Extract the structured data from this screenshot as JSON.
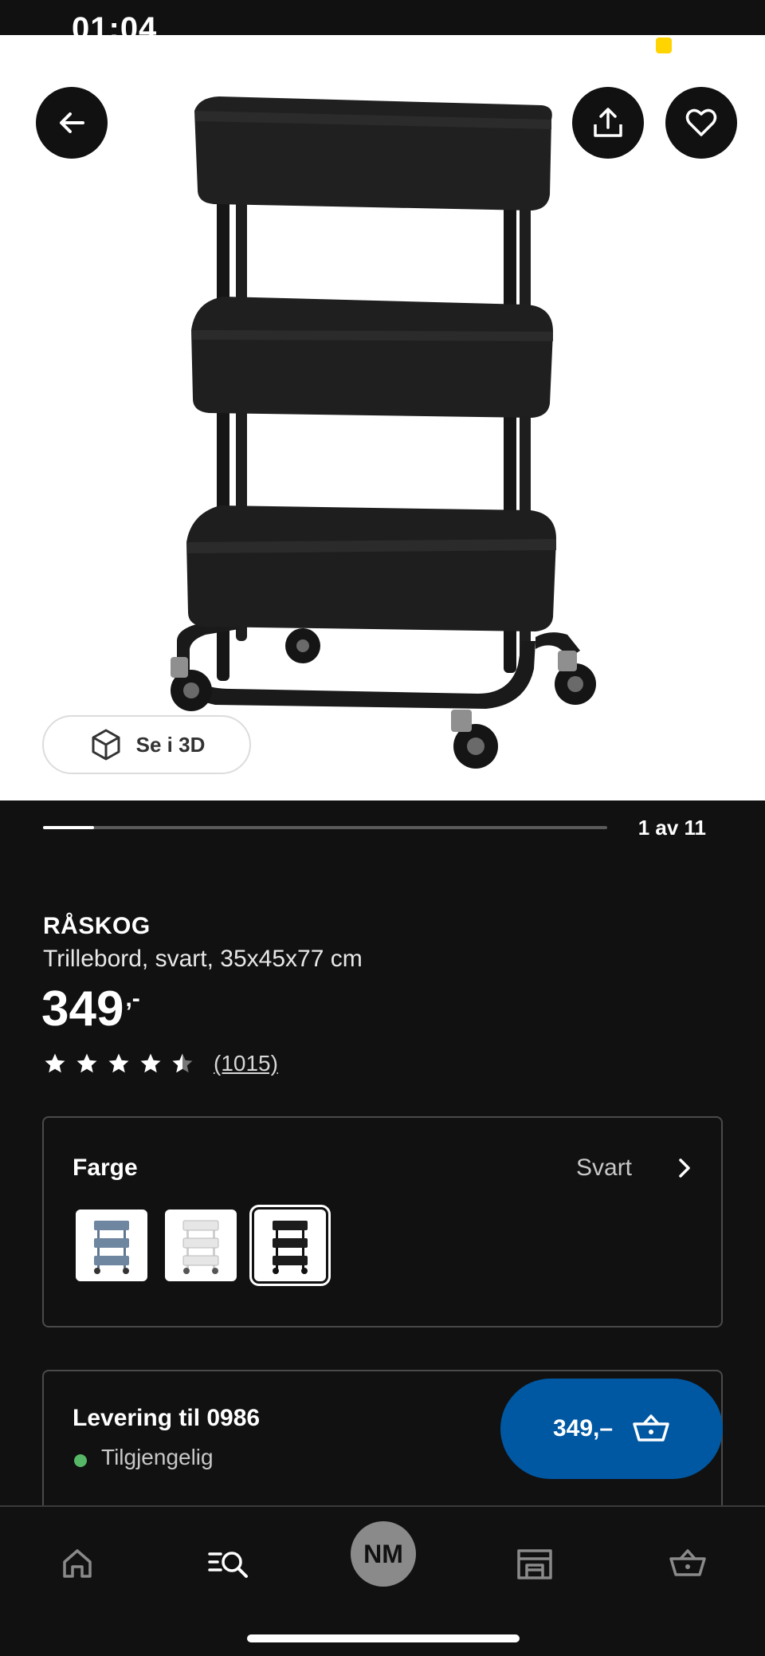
{
  "status_bar": {
    "time": "01:04"
  },
  "gallery": {
    "view_3d_label": "Se i 3D",
    "current": 1,
    "total": 11,
    "counter_text": "1 av 11",
    "progress_fraction": 0.09
  },
  "product": {
    "name": "RÅSKOG",
    "description": "Trillebord, svart, 35x45x77 cm",
    "price": "349",
    "price_suffix": ",-",
    "rating": 4.5,
    "review_count": "(1015)"
  },
  "color_selector": {
    "title": "Farge",
    "selected_value": "Svart",
    "options": [
      {
        "name": "blue-grey",
        "color": "#6f86a0"
      },
      {
        "name": "white",
        "color": "#e9e9e9"
      },
      {
        "name": "black",
        "color": "#1c1c1c"
      }
    ],
    "selected_index": 2
  },
  "delivery": {
    "title": "Levering til 0986",
    "availability": "Tilgjengelig",
    "availability_color": "#56b867"
  },
  "cart_button": {
    "label": "349,–"
  },
  "bottom_nav": {
    "avatar_initials": "NM",
    "items": [
      "home-icon",
      "search-icon",
      "avatar",
      "store-icon",
      "basket-icon"
    ]
  },
  "colors": {
    "accent": "#0058a3",
    "background": "#111111"
  }
}
